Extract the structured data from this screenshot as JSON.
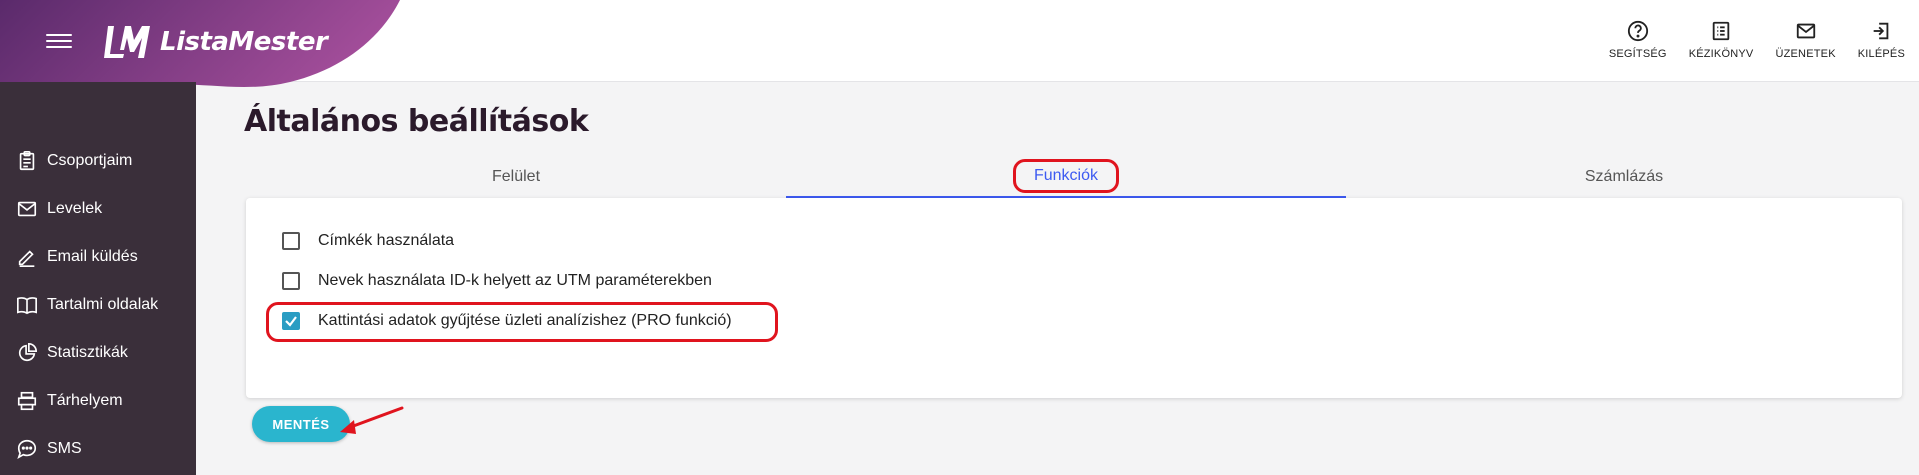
{
  "brand": {
    "name": "ListaMester",
    "gradient_start": "#5a2a6b",
    "gradient_end": "#a64f9c",
    "menu_icon": "hamburger-icon"
  },
  "top_actions": [
    {
      "label": "SEGÍTSÉG",
      "icon": "help-icon"
    },
    {
      "label": "KÉZIKÖNYV",
      "icon": "manual-icon"
    },
    {
      "label": "ÜZENETEK",
      "icon": "mail-icon"
    },
    {
      "label": "KILÉPÉS",
      "icon": "logout-icon"
    }
  ],
  "sidebar": {
    "bg": "#3a2f3a",
    "items": [
      {
        "label": "Csoportjaim",
        "icon": "clipboard-icon"
      },
      {
        "label": "Levelek",
        "icon": "envelope-icon"
      },
      {
        "label": "Email küldés",
        "icon": "pencil-icon"
      },
      {
        "label": "Tartalmi oldalak",
        "icon": "book-icon"
      },
      {
        "label": "Statisztikák",
        "icon": "pie-chart-icon"
      },
      {
        "label": "Tárhelyem",
        "icon": "storage-icon"
      },
      {
        "label": "SMS",
        "icon": "sms-icon"
      }
    ]
  },
  "page": {
    "title": "Általános beállítások"
  },
  "tabs": [
    {
      "label": "Felület",
      "active": false
    },
    {
      "label": "Funkciók",
      "active": true
    },
    {
      "label": "Számlázás",
      "active": false
    }
  ],
  "options": [
    {
      "label": "Címkék használata",
      "checked": false
    },
    {
      "label": "Nevek használata ID-k helyett az UTM paraméterekben",
      "checked": false
    },
    {
      "label": "Kattintási adatok gyűjtése üzleti analízishez (PRO funkció)",
      "checked": true
    }
  ],
  "save_button": {
    "label": "MENTÉS",
    "color": "#2ab5ce"
  },
  "colors": {
    "accent": "#3d5af1",
    "highlight": "#e0141e",
    "checkbox_checked": "#2a9dc3"
  }
}
